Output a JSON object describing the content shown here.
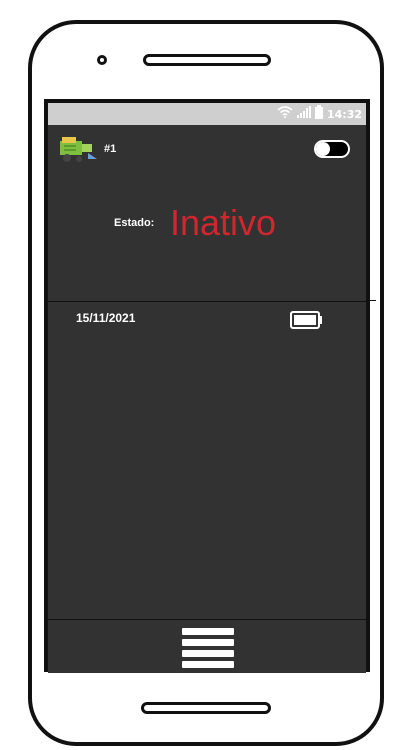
{
  "status_bar": {
    "time": "14:32",
    "icons": [
      "wifi-icon",
      "signal-icon",
      "battery-status-icon"
    ]
  },
  "device": {
    "icon": "harvester-icon",
    "number": "#1",
    "toggle_on": false
  },
  "estado": {
    "label": "Estado:",
    "value": "Inativo",
    "value_color": "#d0262e"
  },
  "entries": [
    {
      "date": "15/11/2021",
      "icon": "battery-icon"
    }
  ],
  "bottom_nav": {
    "menu_icon": "hamburger-menu-icon"
  },
  "colors": {
    "screen_bg": "#323232",
    "status_bar_bg": "#cfcfcf"
  }
}
